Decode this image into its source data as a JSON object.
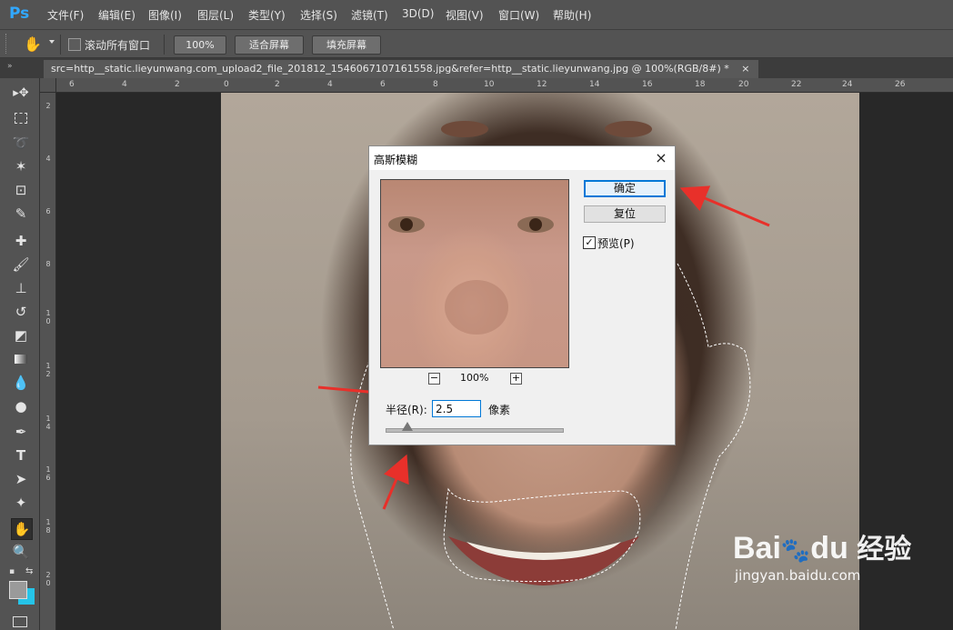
{
  "app": {
    "logo": "Ps"
  },
  "menu": [
    "文件(F)",
    "编辑(E)",
    "图像(I)",
    "图层(L)",
    "类型(Y)",
    "选择(S)",
    "滤镜(T)",
    "3D(D)",
    "视图(V)",
    "窗口(W)",
    "帮助(H)"
  ],
  "options": {
    "scroll_all_label": "滚动所有窗口",
    "zoom_btn": "100%",
    "fit_btn": "适合屏幕",
    "fill_btn": "填充屏幕"
  },
  "document_tab": {
    "title": "src=http__static.lieyunwang.com_upload2_file_201812_1546067107161558.jpg&refer=http__static.lieyunwang.jpg @ 100%(RGB/8#) *",
    "close": "×"
  },
  "rulers": {
    "h": [
      "6",
      "4",
      "2",
      "0",
      "2",
      "4",
      "6",
      "8",
      "10",
      "12",
      "14",
      "16",
      "18",
      "20",
      "22",
      "24",
      "26"
    ],
    "v": [
      "2",
      "4",
      "6",
      "8",
      "10",
      "12",
      "14",
      "16",
      "18",
      "20"
    ]
  },
  "dialog": {
    "title": "高斯模糊",
    "close": "×",
    "ok": "确定",
    "reset": "复位",
    "preview_label": "预览(P)",
    "preview_checked": true,
    "zoom": "100%",
    "zoom_minus": "−",
    "zoom_plus": "+",
    "radius_label": "半径(R):",
    "radius_value": "2.5",
    "radius_unit": "像素",
    "slider_fraction": 0.12
  },
  "watermark": {
    "brand": "Bai",
    "brand2": "du",
    "paw": "🐾",
    "cn": "经验",
    "url": "jingyan.baidu.com"
  },
  "colors": {
    "accent": "#31a8ff",
    "arrow": "#e8302a",
    "fg_swatch": "#9a9a9a",
    "bg_swatch": "#25c4e8"
  }
}
